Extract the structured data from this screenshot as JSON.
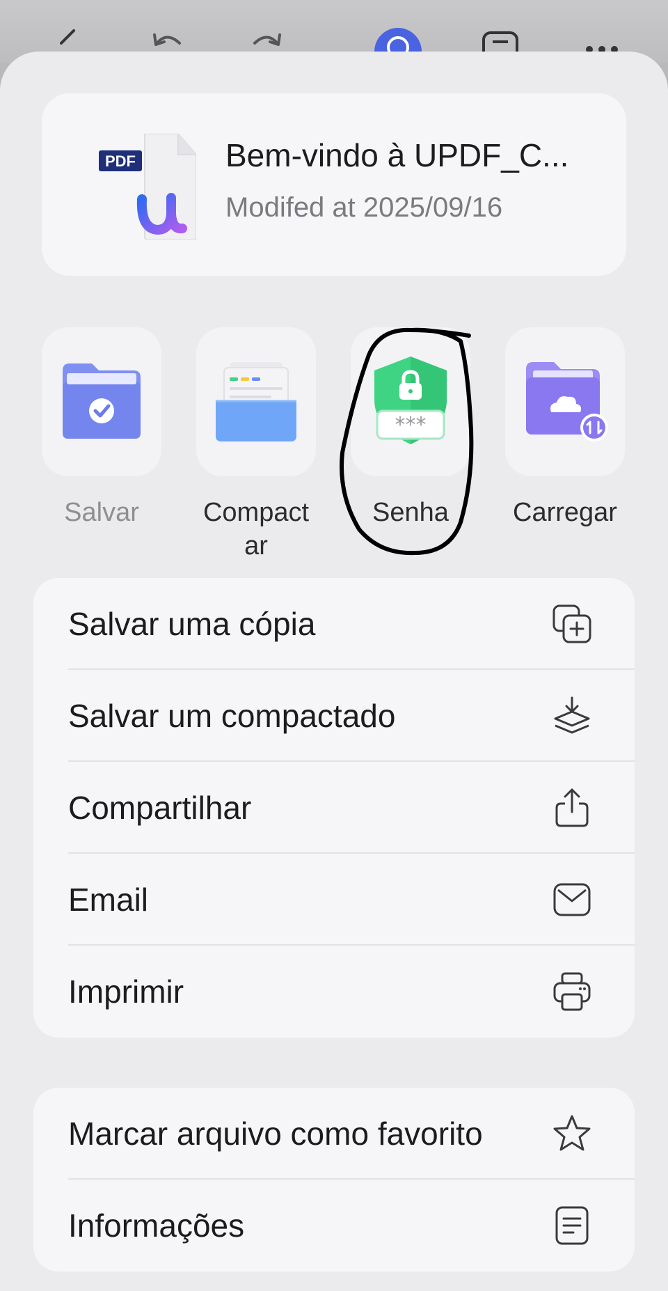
{
  "file": {
    "title": "Bem-vindo à UPDF_C...",
    "modified": "Modifed at 2025/09/16",
    "thumb_badge": "PDF"
  },
  "actions": [
    {
      "label": "Salvar",
      "icon": "folder-check-icon",
      "muted": true
    },
    {
      "label": "Compact\nar",
      "icon": "tray-icon",
      "muted": false
    },
    {
      "label": "Senha",
      "icon": "shield-lock-icon",
      "muted": false
    },
    {
      "label": "Carregar",
      "icon": "cloud-folder-icon",
      "muted": false
    }
  ],
  "menu_group_1": [
    {
      "label": "Salvar uma cópia",
      "icon": "copy-plus-icon"
    },
    {
      "label": "Salvar um compactado",
      "icon": "stack-download-icon"
    },
    {
      "label": "Compartilhar",
      "icon": "share-icon"
    },
    {
      "label": "Email",
      "icon": "mail-icon"
    },
    {
      "label": "Imprimir",
      "icon": "printer-icon"
    }
  ],
  "menu_group_2": [
    {
      "label": "Marcar arquivo como favorito",
      "icon": "star-icon"
    },
    {
      "label": "Informações",
      "icon": "document-icon"
    }
  ],
  "colors": {
    "accent_blue": "#5b6cf0",
    "shield_green": "#3fd483",
    "folder_purple": "#8a78f0"
  }
}
